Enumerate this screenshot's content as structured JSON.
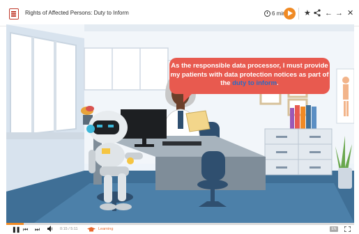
{
  "topbar": {
    "title": "Rights of Affected Persons: Duty to Inform",
    "duration": "6 min.",
    "icons": [
      "document-icon",
      "clock-icon",
      "play-circle-icon",
      "star-icon",
      "share-icon",
      "back-arrow-icon",
      "forward-arrow-icon",
      "close-icon"
    ]
  },
  "scene": {
    "speech_before": "As the responsible data processor, I must provide my patients with data protection notices as part of the ",
    "speech_link": "duty to inform",
    "speech_after": "."
  },
  "player": {
    "time": "0:15 / 5:11",
    "progress": 0.05,
    "section_label": "Learning",
    "language_badge": "EN"
  },
  "colors": {
    "accent": "#f08a24",
    "speech_bubble": "#e85a4f",
    "link": "#2b6cc4"
  }
}
